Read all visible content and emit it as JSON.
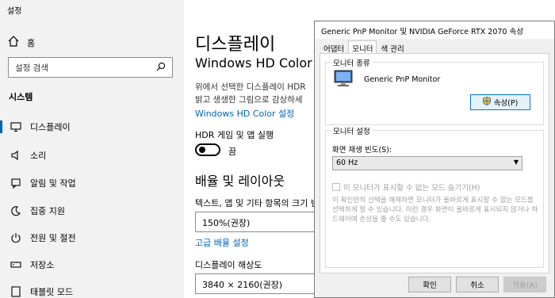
{
  "settings": {
    "window_title": "설정",
    "home_label": "홈",
    "search_placeholder": "설정 검색",
    "section_title": "시스템",
    "nav": [
      {
        "label": "디스플레이",
        "icon": "monitor-icon",
        "active": true
      },
      {
        "label": "소리",
        "icon": "speaker-icon"
      },
      {
        "label": "알림 및 작업",
        "icon": "notification-icon"
      },
      {
        "label": "집중 지원",
        "icon": "moon-icon"
      },
      {
        "label": "전원 및 절전",
        "icon": "power-icon"
      },
      {
        "label": "저장소",
        "icon": "storage-icon"
      },
      {
        "label": "태블릿 모드",
        "icon": "tablet-icon"
      }
    ],
    "content": {
      "page_title": "디스플레이",
      "hd_color_heading": "Windows HD Color",
      "hd_color_desc_line1": "위에서 선택한 디스플레이 HDR",
      "hd_color_desc_line2": "밝고 생생한 그림으로 감상하세",
      "hd_color_link": "Windows HD Color 설정",
      "hdr_label": "HDR 게임 및 앱 실행",
      "hdr_state": "끔",
      "layout_heading": "배율 및 레이아웃",
      "scale_label": "텍스트, 앱 및 기타 항목의 크기 변",
      "scale_value": "150%(권장)",
      "advanced_scale_link": "고급 배율 설정",
      "resolution_label": "디스플레이 해상도",
      "resolution_value": "3840 × 2160(권장)"
    }
  },
  "dialog": {
    "title": "Generic PnP Monitor 및 NVIDIA GeForce RTX 2070 속성",
    "tabs": [
      "어댑터",
      "모니터",
      "색 관리"
    ],
    "active_tab": "모니터",
    "monitor_type_group": "모니터 종류",
    "monitor_name": "Generic PnP Monitor",
    "properties_button": "속성(P)",
    "monitor_settings_group": "모니터 설정",
    "refresh_label": "화면 재생 빈도(S):",
    "refresh_value": "60 Hz",
    "hide_modes_label": "이 모니터가 표시할 수 없는 모드 숨기기(H)",
    "warning_text": "이 확인란의 선택을 해제하면 모니터가 올바르게 표시할 수 없는 모드를 선택하게 할 수 있습니다. 이런 경우 화면이 올바르게 표시되지 않거나 하드웨어에 손상을 줄 수도 있습니다.",
    "ok_label": "확인",
    "cancel_label": "취소",
    "apply_label": "적용(A)"
  },
  "colors": {
    "accent": "#0063b1",
    "sidebar_bg": "#f2f2f2",
    "dialog_bg": "#f0f0f0"
  }
}
